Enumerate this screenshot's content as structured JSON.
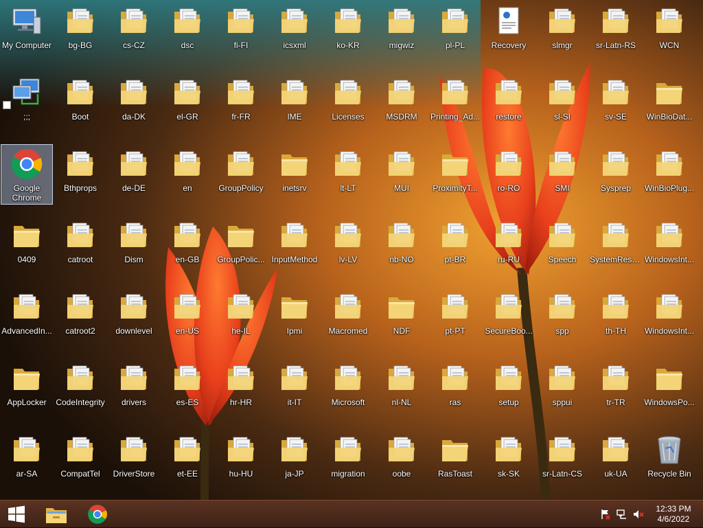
{
  "desktop": {
    "icons": [
      {
        "label": "My Computer",
        "type": "computer"
      },
      {
        "label": ";;;",
        "type": "network"
      },
      {
        "label": "Google Chrome",
        "type": "chrome",
        "selected": true
      },
      {
        "label": "0409",
        "type": "folder"
      },
      {
        "label": "AdvancedIn...",
        "type": "folder-docs"
      },
      {
        "label": "AppLocker",
        "type": "folder"
      },
      {
        "label": "ar-SA",
        "type": "folder-docs"
      },
      {
        "label": "bg-BG",
        "type": "folder-docs"
      },
      {
        "label": "Boot",
        "type": "folder-docs"
      },
      {
        "label": "Bthprops",
        "type": "folder-docs"
      },
      {
        "label": "catroot",
        "type": "folder-docs"
      },
      {
        "label": "catroot2",
        "type": "folder-docs"
      },
      {
        "label": "CodeIntegrity",
        "type": "folder-docs"
      },
      {
        "label": "CompatTel",
        "type": "folder-docs"
      },
      {
        "label": "cs-CZ",
        "type": "folder-docs"
      },
      {
        "label": "da-DK",
        "type": "folder-docs"
      },
      {
        "label": "de-DE",
        "type": "folder-docs"
      },
      {
        "label": "Dism",
        "type": "folder-docs"
      },
      {
        "label": "downlevel",
        "type": "folder-docs"
      },
      {
        "label": "drivers",
        "type": "folder-docs"
      },
      {
        "label": "DriverStore",
        "type": "folder-docs"
      },
      {
        "label": "dsc",
        "type": "folder-docs"
      },
      {
        "label": "el-GR",
        "type": "folder-docs"
      },
      {
        "label": "en",
        "type": "folder-docs"
      },
      {
        "label": "en-GB",
        "type": "folder-docs"
      },
      {
        "label": "en-US",
        "type": "folder-docs"
      },
      {
        "label": "es-ES",
        "type": "folder-docs"
      },
      {
        "label": "et-EE",
        "type": "folder-docs"
      },
      {
        "label": "fi-FI",
        "type": "folder-docs"
      },
      {
        "label": "fr-FR",
        "type": "folder-docs"
      },
      {
        "label": "GroupPolicy",
        "type": "folder-docs"
      },
      {
        "label": "GroupPolic...",
        "type": "folder"
      },
      {
        "label": "he-IL",
        "type": "folder-docs"
      },
      {
        "label": "hr-HR",
        "type": "folder-docs"
      },
      {
        "label": "hu-HU",
        "type": "folder-docs"
      },
      {
        "label": "icsxml",
        "type": "folder-docs"
      },
      {
        "label": "IME",
        "type": "folder-docs"
      },
      {
        "label": "inetsrv",
        "type": "folder"
      },
      {
        "label": "InputMethod",
        "type": "folder-docs"
      },
      {
        "label": "Ipmi",
        "type": "folder"
      },
      {
        "label": "it-IT",
        "type": "folder-docs"
      },
      {
        "label": "ja-JP",
        "type": "folder-docs"
      },
      {
        "label": "ko-KR",
        "type": "folder-docs"
      },
      {
        "label": "Licenses",
        "type": "folder-docs"
      },
      {
        "label": "lt-LT",
        "type": "folder-docs"
      },
      {
        "label": "lv-LV",
        "type": "folder-docs"
      },
      {
        "label": "Macromed",
        "type": "folder-docs"
      },
      {
        "label": "Microsoft",
        "type": "folder-docs"
      },
      {
        "label": "migration",
        "type": "folder-docs"
      },
      {
        "label": "migwiz",
        "type": "folder-docs"
      },
      {
        "label": "MSDRM",
        "type": "folder-docs"
      },
      {
        "label": "MUI",
        "type": "folder-docs"
      },
      {
        "label": "nb-NO",
        "type": "folder-docs"
      },
      {
        "label": "NDF",
        "type": "folder"
      },
      {
        "label": "nl-NL",
        "type": "folder-docs"
      },
      {
        "label": "oobe",
        "type": "folder-docs"
      },
      {
        "label": "pl-PL",
        "type": "folder-docs"
      },
      {
        "label": "Printing_Ad...",
        "type": "folder-docs"
      },
      {
        "label": "ProximityT...",
        "type": "folder"
      },
      {
        "label": "pt-BR",
        "type": "folder-docs"
      },
      {
        "label": "pt-PT",
        "type": "folder-docs"
      },
      {
        "label": "ras",
        "type": "folder-docs"
      },
      {
        "label": "RasToast",
        "type": "folder"
      },
      {
        "label": "Recovery",
        "type": "file"
      },
      {
        "label": "restore",
        "type": "folder-docs"
      },
      {
        "label": "ro-RO",
        "type": "folder-docs"
      },
      {
        "label": "ru-RU",
        "type": "folder-docs"
      },
      {
        "label": "SecureBoo...",
        "type": "folder-docs"
      },
      {
        "label": "setup",
        "type": "folder-docs"
      },
      {
        "label": "sk-SK",
        "type": "folder-docs"
      },
      {
        "label": "slmgr",
        "type": "folder-docs"
      },
      {
        "label": "sl-SI",
        "type": "folder-docs"
      },
      {
        "label": "SMI",
        "type": "folder-docs"
      },
      {
        "label": "Speech",
        "type": "folder-docs"
      },
      {
        "label": "spp",
        "type": "folder-docs"
      },
      {
        "label": "sppui",
        "type": "folder-docs"
      },
      {
        "label": "sr-Latn-CS",
        "type": "folder-docs"
      },
      {
        "label": "sr-Latn-RS",
        "type": "folder-docs"
      },
      {
        "label": "sv-SE",
        "type": "folder-docs"
      },
      {
        "label": "Sysprep",
        "type": "folder-docs"
      },
      {
        "label": "SystemRese...",
        "type": "folder-docs"
      },
      {
        "label": "th-TH",
        "type": "folder-docs"
      },
      {
        "label": "tr-TR",
        "type": "folder-docs"
      },
      {
        "label": "uk-UA",
        "type": "folder-docs"
      },
      {
        "label": "WCN",
        "type": "folder-docs"
      },
      {
        "label": "WinBioDat...",
        "type": "folder"
      },
      {
        "label": "WinBioPlug...",
        "type": "folder-docs"
      },
      {
        "label": "WindowsInt...",
        "type": "folder-docs"
      },
      {
        "label": "WindowsInt...",
        "type": "folder-docs"
      },
      {
        "label": "WindowsPo...",
        "type": "folder"
      },
      {
        "label": "Recycle Bin",
        "type": "recycle"
      }
    ]
  },
  "taskbar": {
    "start_icon": "windows-logo-icon",
    "pinned": [
      {
        "name": "file-explorer",
        "icon": "folder-icon"
      },
      {
        "name": "google-chrome",
        "icon": "chrome-icon"
      }
    ],
    "tray": {
      "icons": [
        "action-center-flag-icon",
        "network-icon",
        "speaker-muted-icon"
      ],
      "time": "12:33 PM",
      "date": "4/6/2022"
    }
  },
  "colors": {
    "taskbar": "#4a2a1c",
    "folder": "#f3d477",
    "accent_selection": "#aac8f0"
  }
}
